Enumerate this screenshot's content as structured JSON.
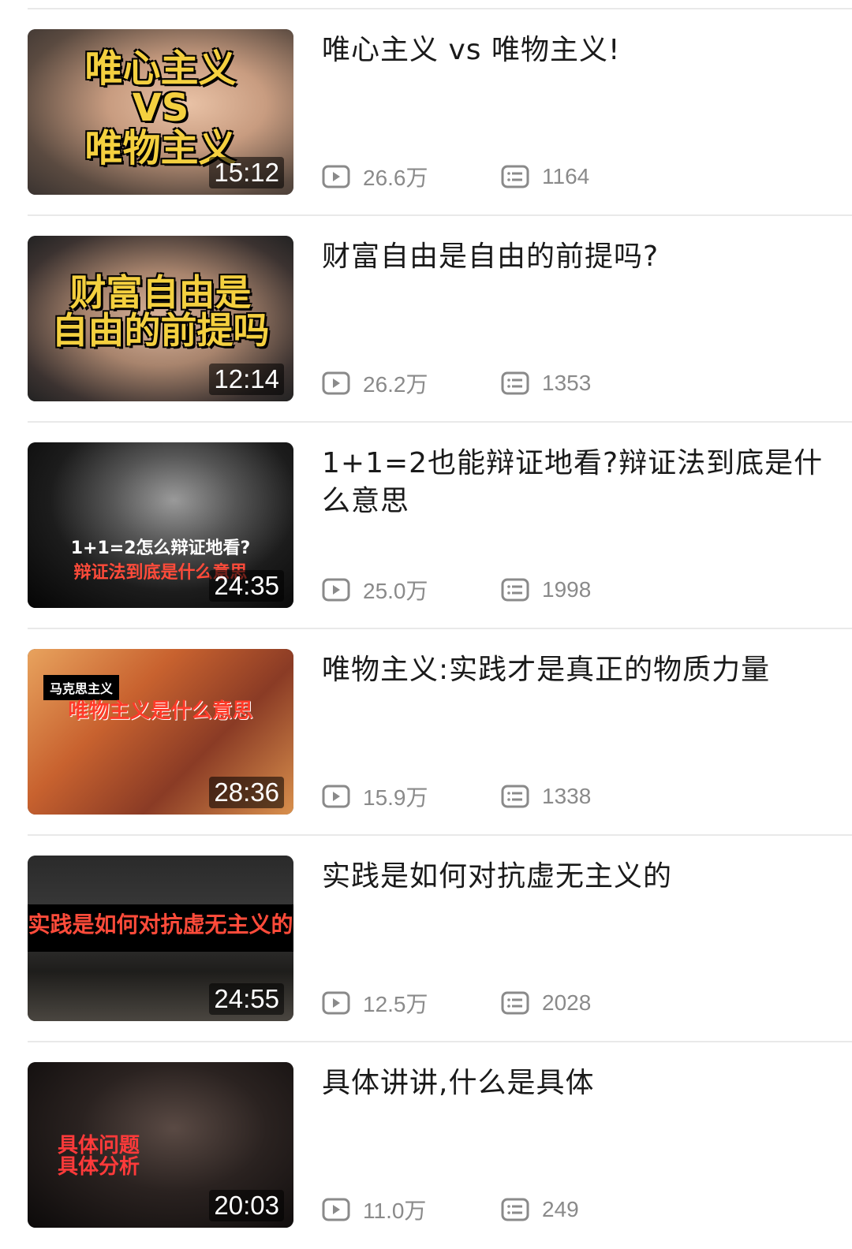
{
  "videos": [
    {
      "thumb_text": "唯心主义\nVS\n唯物主义",
      "duration": "15:12",
      "title": "唯心主义 vs 唯物主义!",
      "views": "26.6万",
      "comments": "1164"
    },
    {
      "thumb_text": "财富自由是\n自由的前提吗",
      "duration": "12:14",
      "title": "财富自由是自由的前提吗?",
      "views": "26.2万",
      "comments": "1353"
    },
    {
      "thumb_text": "1+1=2怎么辩证地看?",
      "thumb_sub": "辩证法到底是什么意思",
      "duration": "24:35",
      "title": "1+1=2也能辩证地看?辩证法到底是什么意思",
      "views": "25.0万",
      "comments": "1998"
    },
    {
      "thumb_tag": "马克思主义",
      "thumb_text": "唯物主义是什么意思",
      "duration": "28:36",
      "title": "唯物主义:实践才是真正的物质力量",
      "views": "15.9万",
      "comments": "1338"
    },
    {
      "thumb_text": "实践是如何对抗虚无主义的",
      "duration": "24:55",
      "title": "实践是如何对抗虚无主义的",
      "views": "12.5万",
      "comments": "2028"
    },
    {
      "thumb_text": "具体问题\n  具体分析",
      "duration": "20:03",
      "title": "具体讲讲,什么是具体",
      "views": "11.0万",
      "comments": "249"
    }
  ],
  "icons": {
    "views": "play-icon",
    "comments": "danmaku-icon"
  }
}
